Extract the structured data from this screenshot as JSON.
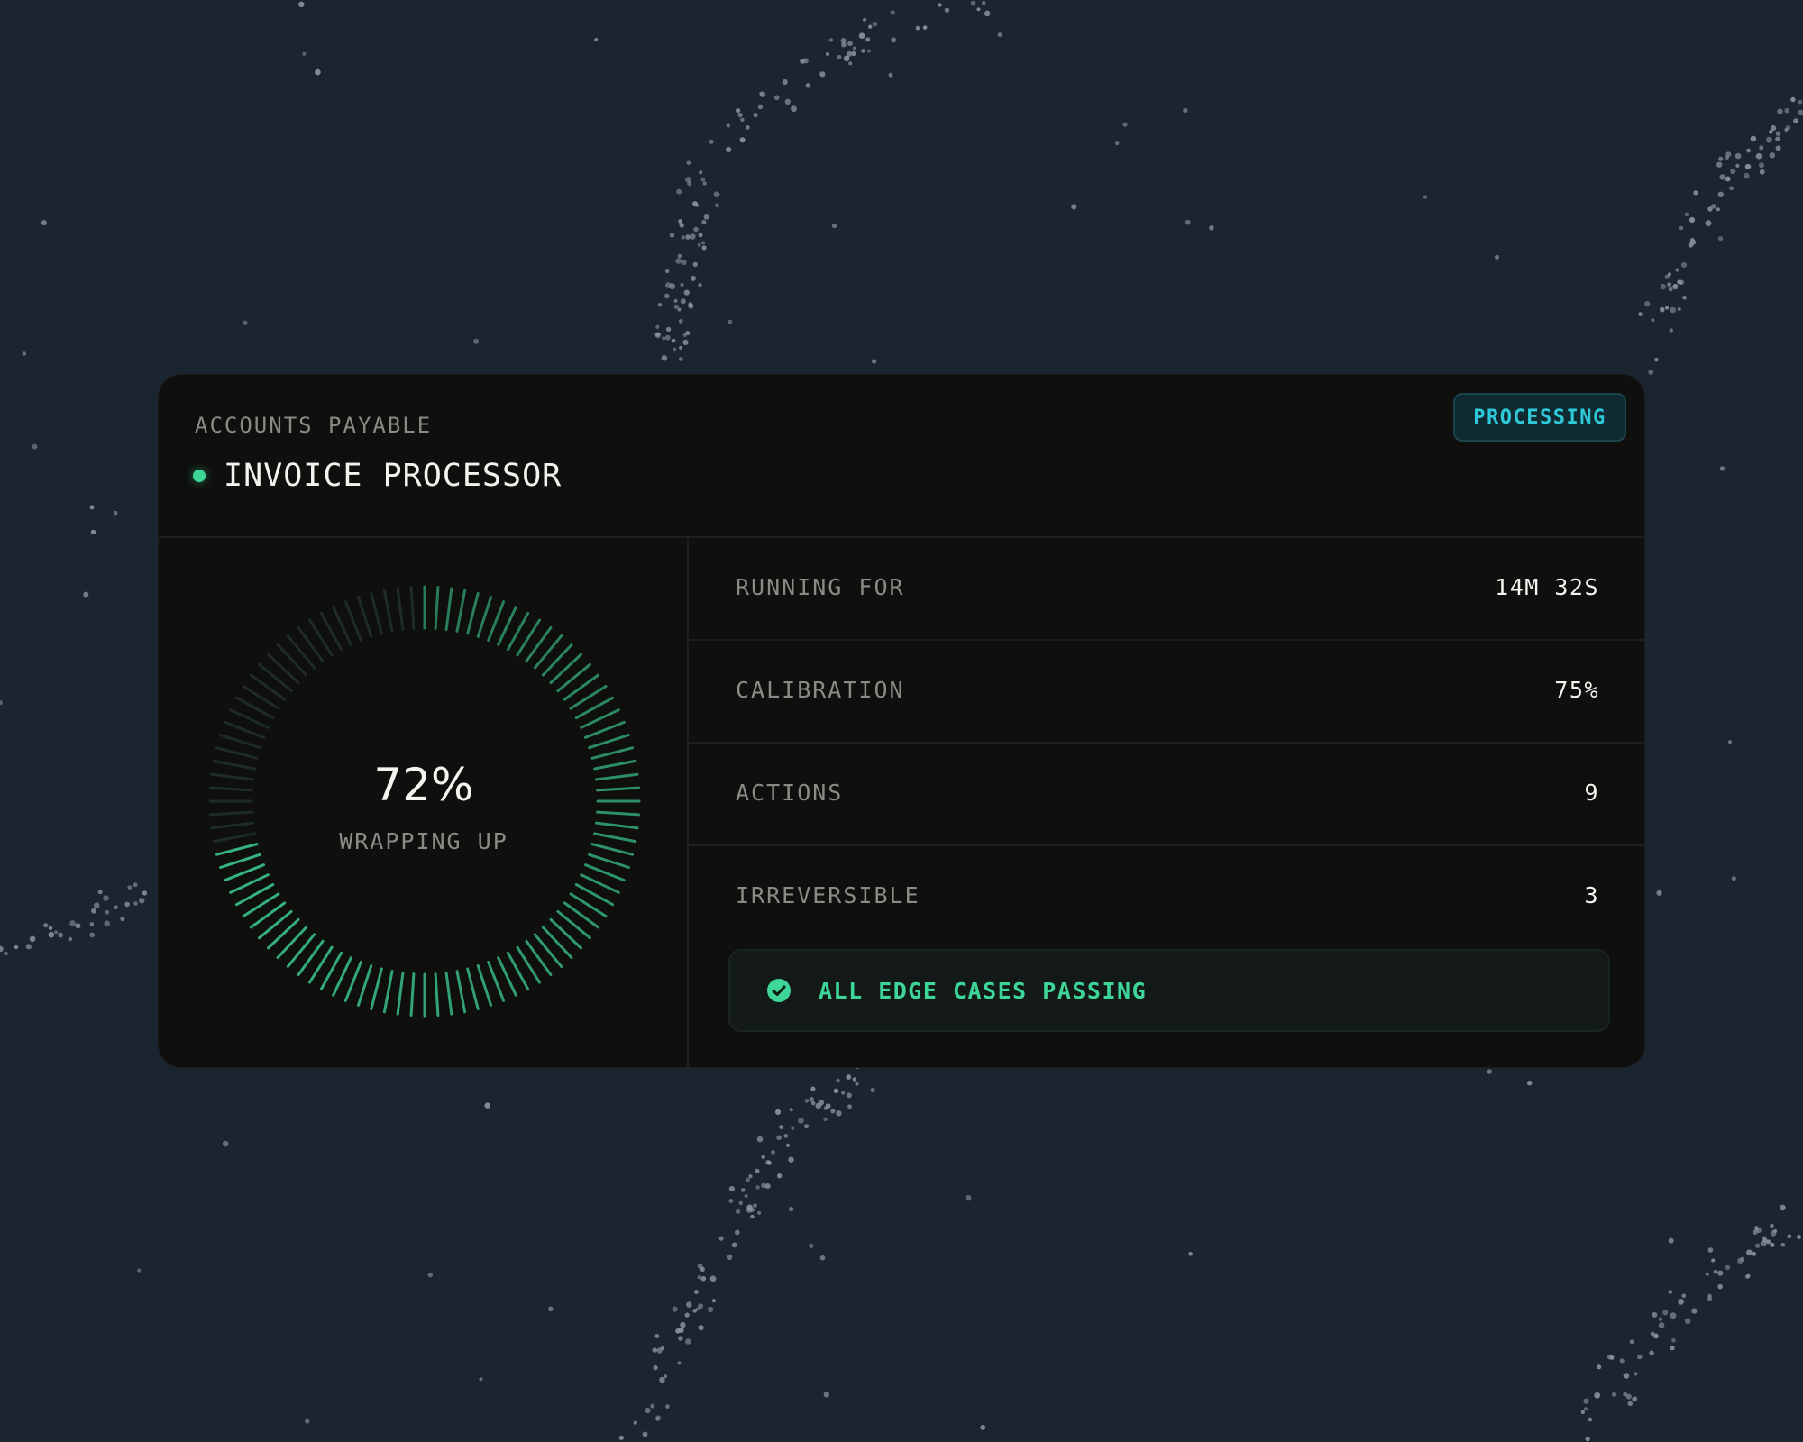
{
  "header": {
    "eyebrow": "ACCOUNTS PAYABLE",
    "title": "INVOICE PROCESSOR",
    "status_badge": "PROCESSING"
  },
  "gauge": {
    "progress_percent": 72,
    "value_text": "72%",
    "label": "WRAPPING UP"
  },
  "stats": [
    {
      "label": "RUNNING FOR",
      "value": "14M 32S"
    },
    {
      "label": "CALIBRATION",
      "value": "75%"
    },
    {
      "label": "ACTIONS",
      "value": "9"
    },
    {
      "label": "IRREVERSIBLE",
      "value": "3"
    }
  ],
  "check": {
    "icon": "check-circle-icon",
    "text": "ALL EDGE CASES PASSING"
  },
  "colors": {
    "background": "#1b2530",
    "card": "#0f0f0e",
    "accent_green": "#3ed598",
    "accent_cyan": "#2ec9d9",
    "muted_text": "#8a8a86",
    "bright_text": "#f4f4f1"
  }
}
